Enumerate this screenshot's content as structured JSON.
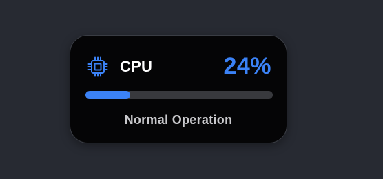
{
  "widget": {
    "title": "CPU",
    "value_text": "24%",
    "usage_fraction": 0.24,
    "status": "Normal Operation",
    "icon": "cpu-chip-icon",
    "colors": {
      "accent": "#3b82f6",
      "background": "#272a32",
      "card": "#050506",
      "track": "#38393d",
      "status_text": "#c9c9cc"
    }
  }
}
